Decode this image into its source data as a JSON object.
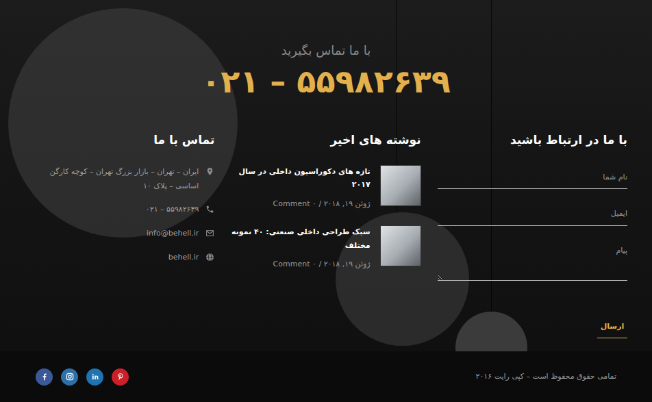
{
  "banner": {
    "title": "با ما تماس بگیرید",
    "phone": "۰۲۱ – ۵۵۹۸۲۶۳۹"
  },
  "form": {
    "title": "با ما در ارتباط باشید",
    "fields": [
      {
        "placeholder": "نام شما",
        "kind": "text"
      },
      {
        "placeholder": "ایمیل",
        "kind": "text"
      },
      {
        "placeholder": "پیام",
        "kind": "textarea"
      }
    ],
    "submit": "ارسال"
  },
  "recent_posts": {
    "title": "نوشته های اخیر",
    "items": [
      {
        "title": "تازه های دکوراسیون داخلی در سال ۲۰۱۷",
        "meta": "ژوئن ۱۹, ۲۰۱۸ / ۰ Comment"
      },
      {
        "title": "سبک طراحی داخلی صنعتی: ۴۰ نمونه مختلف",
        "meta": "ژوئن ۱۹, ۲۰۱۸ / ۰ Comment"
      }
    ]
  },
  "contact_info": {
    "title": "تماس با ما",
    "items": [
      {
        "kind": "address",
        "text": "ایران – تهران – بازار بزرگ تهران – کوچه کارگن اساسی – پلاک ۱۰"
      },
      {
        "kind": "phone",
        "text": "۰۲۱ – ۵۵۹۸۲۶۳۹"
      },
      {
        "kind": "email",
        "text": "info@behell.ir"
      },
      {
        "kind": "website",
        "text": "behell.ir"
      }
    ]
  },
  "footer": {
    "copyright": "تمامی حقوق محفوظ است – کپی رایت ۲۰۱۶",
    "social": [
      {
        "kind": "facebook",
        "color": "#3b5998"
      },
      {
        "kind": "instagram",
        "color": "#2f6fa8"
      },
      {
        "kind": "linkedin",
        "color": "#1f73b0"
      },
      {
        "kind": "pinterest",
        "color": "#cb2027"
      }
    ]
  }
}
